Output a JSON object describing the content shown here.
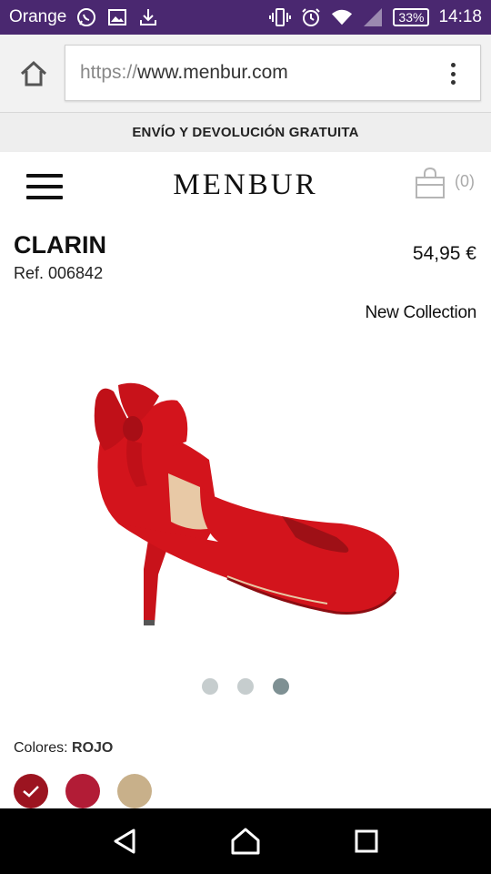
{
  "status_bar": {
    "carrier": "Orange",
    "battery": "33%",
    "time": "14:18",
    "icons": [
      "whatsapp-icon",
      "image-icon",
      "download-icon",
      "vibrate-icon",
      "alarm-icon",
      "wifi-icon",
      "signal-icon",
      "battery-icon"
    ]
  },
  "browser": {
    "url_scheme": "https://",
    "url_host": "www.menbur.com",
    "home_icon": "home-icon",
    "menu_icon": "overflow-menu-icon"
  },
  "promo": {
    "text": "ENVÍO Y DEVOLUCIÓN GRATUITA"
  },
  "header": {
    "logo": "MENBUR",
    "cart_count": "(0)",
    "menu_icon": "hamburger-icon",
    "cart_icon": "shopping-bag-icon"
  },
  "product": {
    "name": "CLARIN",
    "ref": "Ref. 006842",
    "price": "54,95 €",
    "collection": "New Collection"
  },
  "carousel": {
    "total": 3,
    "active_index": 2
  },
  "colors": {
    "label": "Colores:",
    "selected": "ROJO",
    "swatches": [
      {
        "hex": "#9c1420",
        "selected": true
      },
      {
        "hex": "#b21c36",
        "selected": false
      },
      {
        "hex": "#c8b08a",
        "selected": false
      }
    ]
  },
  "nav": {
    "back_icon": "back-icon",
    "home_icon": "home-icon",
    "recents_icon": "recents-icon"
  },
  "theme": {
    "status_bar_bg": "#4a2870",
    "shoe_red": "#d3141c"
  }
}
